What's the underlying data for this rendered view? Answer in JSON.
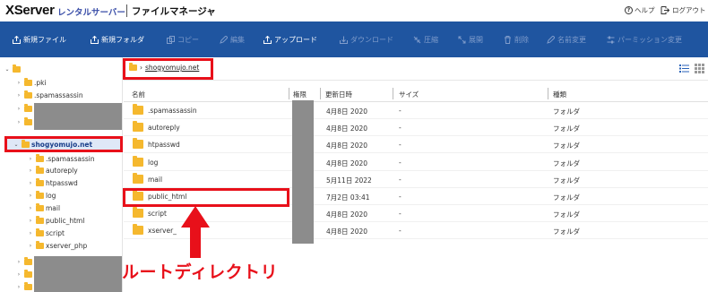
{
  "header": {
    "logo": "XServer",
    "logo_sub": "レンタルサーバー",
    "app_title": "ファイルマネージャ",
    "help_label": "ヘルプ",
    "logout_label": "ログアウト"
  },
  "toolbar": {
    "new_file": "新規ファイル",
    "new_folder": "新規フォルダ",
    "copy": "コピー",
    "edit": "編集",
    "upload": "アップロード",
    "download": "ダウンロード",
    "compress": "圧縮",
    "extract": "展開",
    "delete": "削除",
    "rename": "名前変更",
    "permission": "パーミッション変更"
  },
  "sidebar": {
    "items": [
      {
        "label": ""
      },
      {
        "label": ".pki"
      },
      {
        "label": ".spamassassin"
      },
      {
        "label": ""
      },
      {
        "label": ""
      },
      {
        "label": "shogyomujo.net"
      },
      {
        "label": ".spamassassin"
      },
      {
        "label": "autoreply"
      },
      {
        "label": "htpasswd"
      },
      {
        "label": "log"
      },
      {
        "label": "mail"
      },
      {
        "label": "public_html"
      },
      {
        "label": "script"
      },
      {
        "label": "xserver_php"
      },
      {
        "label": ""
      },
      {
        "label": ""
      },
      {
        "label": ""
      }
    ]
  },
  "path": {
    "current": "shogyomujo.net"
  },
  "table": {
    "headers": {
      "name": "名前",
      "permission": "権限",
      "modified": "更新日時",
      "size": "サイズ",
      "type": "種類"
    },
    "rows": [
      {
        "name": ".spamassassin",
        "modified": "4月8日 2020",
        "size": "-",
        "type": "フォルダ"
      },
      {
        "name": "autoreply",
        "modified": "4月8日 2020",
        "size": "-",
        "type": "フォルダ"
      },
      {
        "name": "htpasswd",
        "modified": "4月8日 2020",
        "size": "-",
        "type": "フォルダ"
      },
      {
        "name": "log",
        "modified": "4月8日 2020",
        "size": "-",
        "type": "フォルダ"
      },
      {
        "name": "mail",
        "modified": "5月11日 2022",
        "size": "-",
        "type": "フォルダ"
      },
      {
        "name": "public_html",
        "modified": "7月2日 03:41",
        "size": "-",
        "type": "フォルダ"
      },
      {
        "name": "script",
        "modified": "4月8日 2020",
        "size": "-",
        "type": "フォルダ"
      },
      {
        "name": "xserver_",
        "modified": "4月8日 2020",
        "size": "-",
        "type": "フォルダ"
      }
    ]
  },
  "annotation": {
    "text": "ルートディレクトリ",
    "color": "#e8101a"
  },
  "colors": {
    "toolbar": "#1f55a0",
    "folder": "#f5b82e",
    "accent_red": "#e8101a"
  }
}
